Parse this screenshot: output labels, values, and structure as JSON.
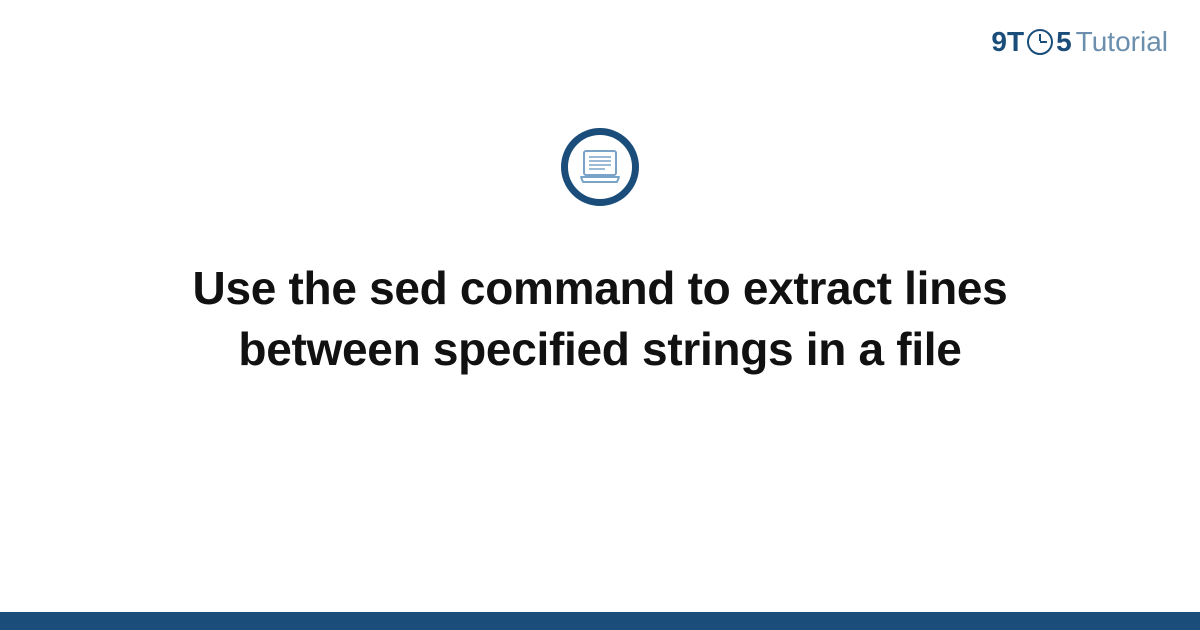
{
  "logo": {
    "part1": "9T",
    "part2": "5",
    "part3": "Tutorial"
  },
  "title": "Use the sed command to extract lines between specified strings in a file",
  "colors": {
    "primary": "#1a4d7a",
    "secondary": "#6b8fad"
  }
}
